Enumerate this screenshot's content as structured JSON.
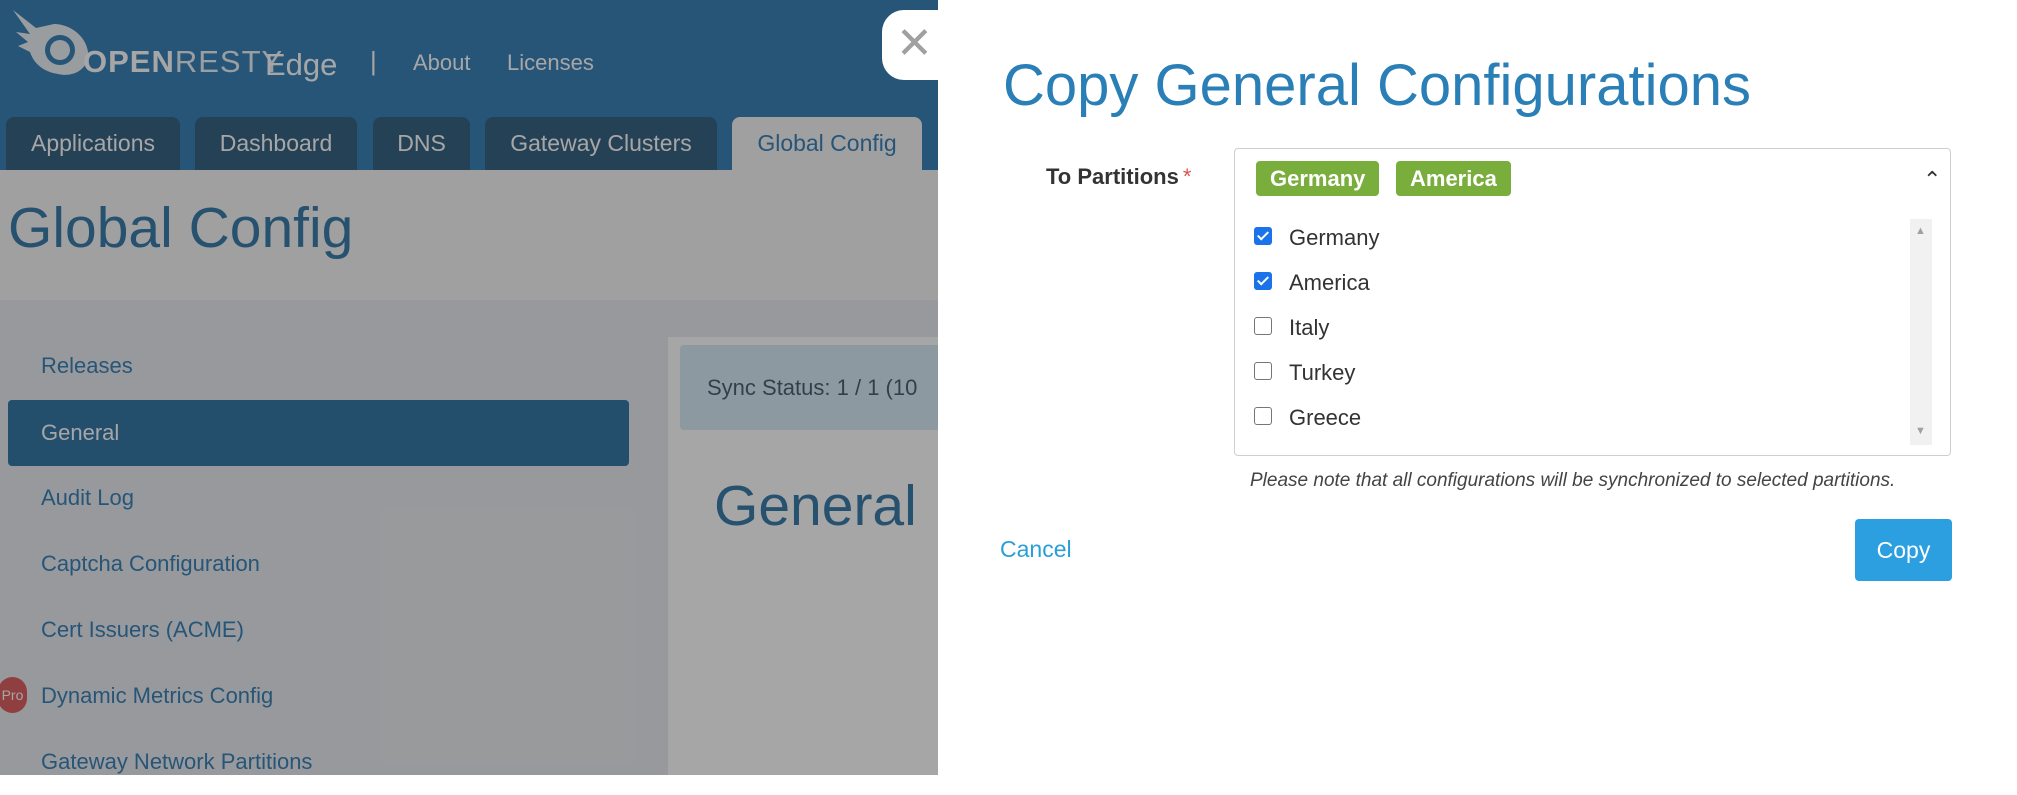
{
  "header": {
    "logo_text_bold": "OPEN",
    "logo_text_thin": "RESTY",
    "product": "Edge",
    "separator": "|",
    "links": [
      "About",
      "Licenses"
    ]
  },
  "tabs": [
    {
      "label": "Applications",
      "active": false
    },
    {
      "label": "Dashboard",
      "active": false
    },
    {
      "label": "DNS",
      "active": false
    },
    {
      "label": "Gateway Clusters",
      "active": false
    },
    {
      "label": "Global Config",
      "active": true
    }
  ],
  "page": {
    "title": "Global Config"
  },
  "sidebar": {
    "items": [
      {
        "label": "Releases",
        "active": false
      },
      {
        "label": "General",
        "active": true
      },
      {
        "label": "Audit Log",
        "active": false
      },
      {
        "label": "Captcha Configuration",
        "active": false
      },
      {
        "label": "Cert Issuers (ACME)",
        "active": false
      },
      {
        "label": "Dynamic Metrics Config",
        "active": false,
        "badge": "Pro"
      },
      {
        "label": "Gateway Network Partitions",
        "active": false
      }
    ]
  },
  "main": {
    "sync_status": "Sync Status:   1 / 1 (10",
    "heading": "General"
  },
  "drawer": {
    "close_icon": "close-icon",
    "title": "Copy General Configurations",
    "field_label": "To Partitions",
    "required_mark": "*",
    "selected_tags": [
      "Germany",
      "America"
    ],
    "options": [
      {
        "label": "Germany",
        "checked": true
      },
      {
        "label": "America",
        "checked": true
      },
      {
        "label": "Italy",
        "checked": false
      },
      {
        "label": "Turkey",
        "checked": false
      },
      {
        "label": "Greece",
        "checked": false
      }
    ],
    "caret_icon": "chevron-up-icon",
    "note": "Please note that all configurations will be synchronized to selected partitions.",
    "cancel_label": "Cancel",
    "copy_label": "Copy"
  },
  "colors": {
    "header_bg": "#0a64a8",
    "tab_bg": "#083f66",
    "tag_green": "#79ad3c",
    "primary_button": "#2b9fe0",
    "title_blue": "#2a7fb6"
  }
}
